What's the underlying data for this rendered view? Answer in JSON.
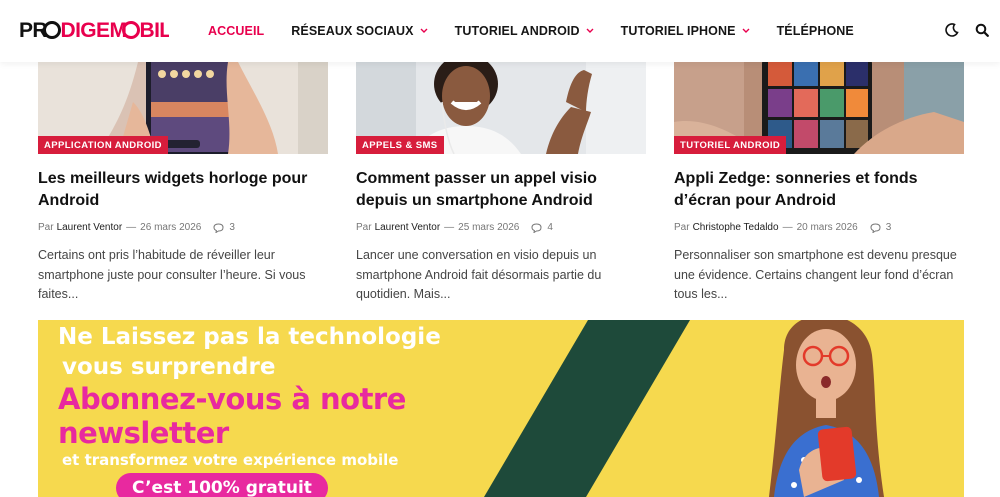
{
  "header": {
    "logo_text": "PRODIGEMOBILE",
    "nav": [
      {
        "label": "ACCUEIL",
        "active": true,
        "dropdown": false
      },
      {
        "label": "RÉSEAUX SOCIAUX",
        "active": false,
        "dropdown": true
      },
      {
        "label": "TUTORIEL ANDROID",
        "active": false,
        "dropdown": true
      },
      {
        "label": "TUTORIEL IPHONE",
        "active": false,
        "dropdown": true
      },
      {
        "label": "TÉLÉPHONE",
        "active": false,
        "dropdown": false
      }
    ],
    "icons": [
      "moon-icon",
      "search-icon"
    ]
  },
  "articles": [
    {
      "category": "APPLICATION ANDROID",
      "title": "Les meilleurs widgets horloge pour Android",
      "by": "Par",
      "author": "Laurent Ventor",
      "date": "26 mars 2026",
      "comments": "3",
      "excerpt": "Certains ont pris l’habitude de réveiller leur smartphone juste pour consulter l’heure. Si vous faites..."
    },
    {
      "category": "APPELS & SMS",
      "title": "Comment passer un appel visio depuis un smartphone Android",
      "by": "Par",
      "author": "Laurent Ventor",
      "date": "25 mars 2026",
      "comments": "4",
      "excerpt": "Lancer une conversation en visio depuis un smartphone Android fait désormais partie du quotidien. Mais..."
    },
    {
      "category": "TUTORIEL ANDROID",
      "title": "Appli Zedge: sonneries et fonds d’écran pour Android",
      "by": "Par",
      "author": "Christophe Tedaldo",
      "date": "20 mars 2026",
      "comments": "3",
      "excerpt": "Personnaliser son smartphone est devenu presque une évidence. Certains changent leur fond d’écran tous les..."
    }
  ],
  "banner": {
    "line1": "Ne Laissez pas la technologie",
    "line2": "vous surprendre",
    "line3": "Abonnez-vous à notre",
    "line4": "newsletter",
    "line5": "et transformez votre expérience mobile",
    "cta": "C’est 100% gratuit"
  },
  "colors": {
    "accent": "#e8004d",
    "category_badge": "#d71d3c",
    "banner_bg": "#f6d94e",
    "banner_stripe": "#1e4a3a",
    "banner_pink": "#e8299f"
  }
}
